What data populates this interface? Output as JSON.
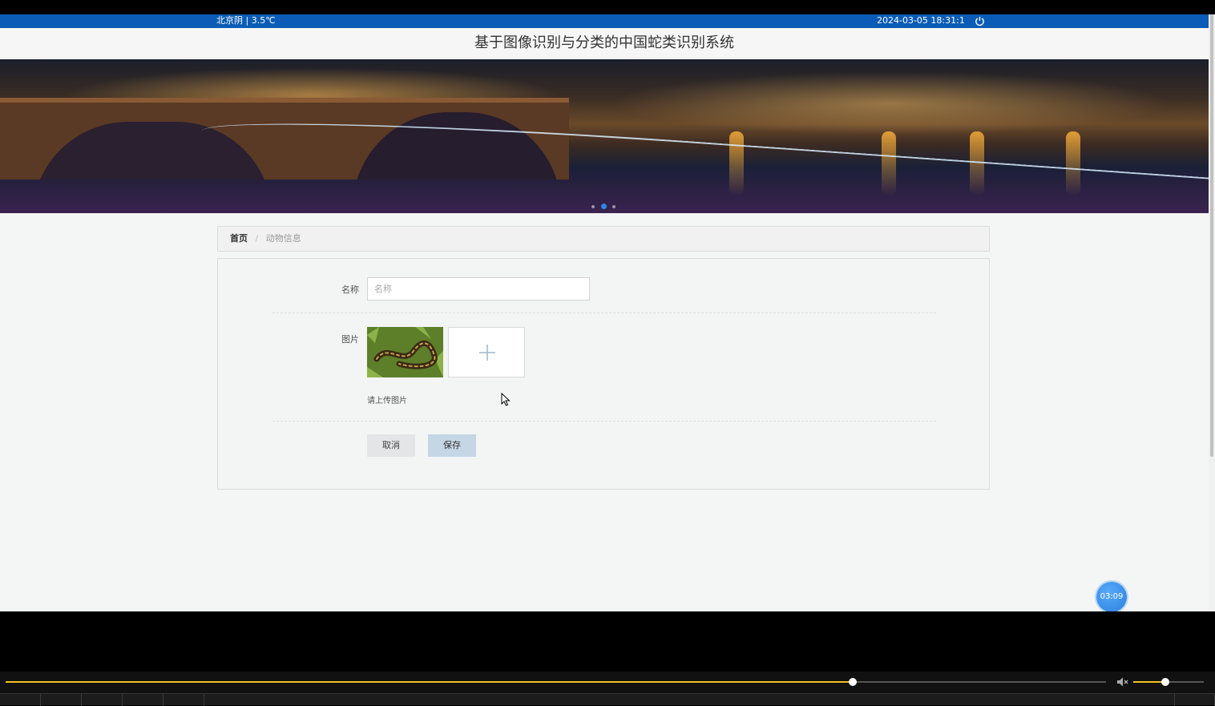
{
  "topbar": {
    "weather": "北京阴 | 3.5℃",
    "datetime": "2024-03-05   18:31:1",
    "power_icon": "power-icon"
  },
  "header": {
    "title": "基于图像识别与分类的中国蛇类识别系统"
  },
  "banner": {
    "slide_count": 3,
    "active_slide": 2
  },
  "breadcrumb": {
    "home": "首页",
    "separator": "/",
    "current": "动物信息"
  },
  "form": {
    "name_label": "名称",
    "name_placeholder": "名称",
    "name_value": "",
    "image_label": "图片",
    "thumbnail_icon": "snake-photo",
    "upload_icon": "plus-icon",
    "upload_hint": "请上传图片",
    "cancel_label": "取消",
    "save_label": "保存"
  },
  "timer": {
    "text": "03:09"
  },
  "player": {
    "progress": 0.77,
    "volume": 0.45,
    "mute_icon": "speaker-muted-icon",
    "accent_color": "#f3c21b"
  },
  "colors": {
    "topbar": "#0b5cb6",
    "timer": "#3a8ef0"
  }
}
